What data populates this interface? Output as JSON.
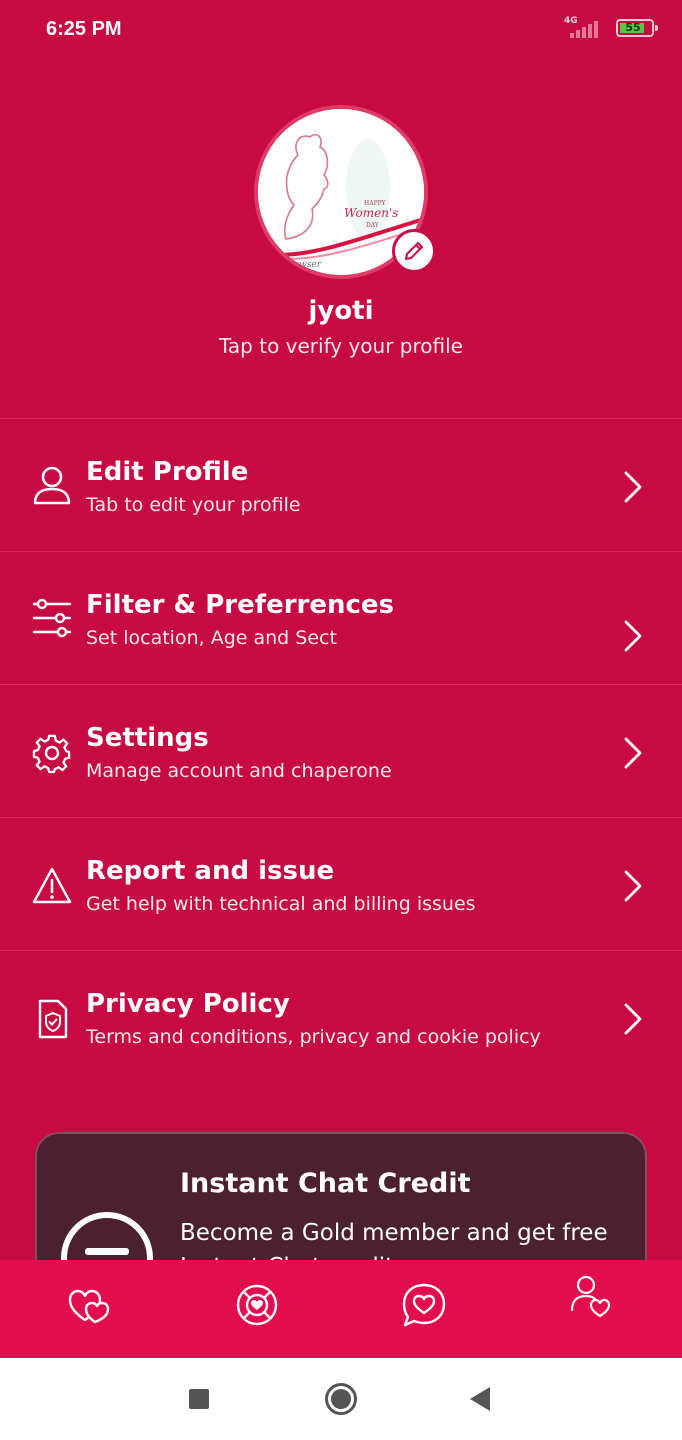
{
  "status_bar": {
    "time": "6:25 PM",
    "network": "4G",
    "battery_level": "55",
    "battery_color": "#5dc342"
  },
  "colors": {
    "background": "#c80a42",
    "bottom_nav": "#e30d4e",
    "card": "#4b2130"
  },
  "profile": {
    "name": "jyoti",
    "verify_text": "Tap to verify your profile",
    "avatar_text": "HAPPY Women's DAY",
    "avatar_footer": "Powser"
  },
  "menu": [
    {
      "title": "Edit Profile",
      "subtitle": "Tab to edit your profile",
      "icon": "user-icon"
    },
    {
      "title": "Filter & Preferrences",
      "subtitle": "Set location, Age and Sect",
      "icon": "sliders-icon"
    },
    {
      "title": "Settings",
      "subtitle": "Manage account and chaperone",
      "icon": "gear-icon"
    },
    {
      "title": "Report and issue",
      "subtitle": "Get help with technical and billing issues",
      "icon": "warning-icon"
    },
    {
      "title": "Privacy Policy",
      "subtitle": "Terms and conditions, privacy  and cookie policy",
      "icon": "shield-document-icon"
    }
  ],
  "credit_card": {
    "title": "Instant Chat Credit",
    "description": "Become a Gold member and get free Instant Chat credits"
  },
  "bottom_nav": [
    {
      "icon": "hearts-icon"
    },
    {
      "icon": "lifebuoy-heart-icon"
    },
    {
      "icon": "chat-heart-icon"
    },
    {
      "icon": "profile-heart-icon"
    }
  ],
  "system_nav": [
    {
      "icon": "recents-square-icon"
    },
    {
      "icon": "home-circle-icon"
    },
    {
      "icon": "back-triangle-icon"
    }
  ]
}
